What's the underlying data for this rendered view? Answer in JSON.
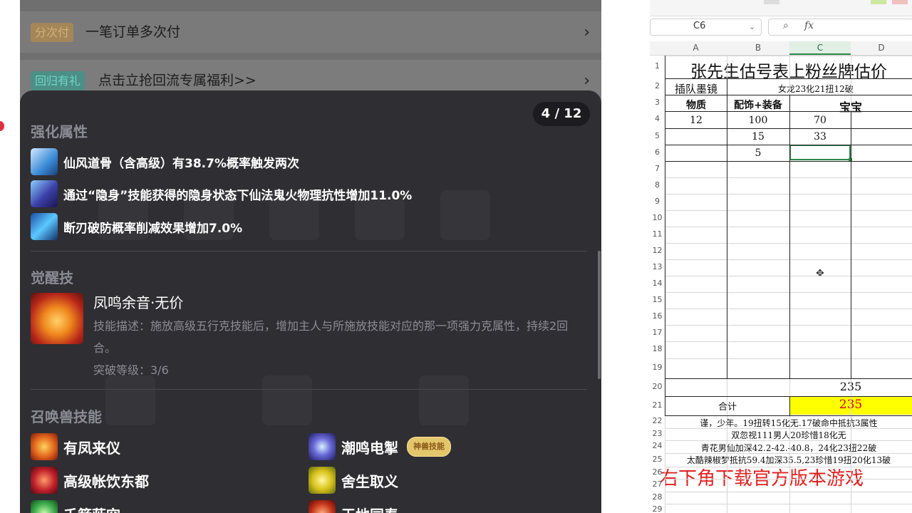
{
  "app": {
    "row1": {
      "tag": "分次付",
      "text": "一笔订单多次付"
    },
    "row2": {
      "tag": "回归有礼",
      "text": "点击立抢回流专属福利>>"
    },
    "chevron": "›"
  },
  "popup": {
    "counter": "4 / 12",
    "enhance": {
      "title": "强化属性",
      "items": [
        {
          "text": "仙风道骨（含高级）有38.7%概率触发两次",
          "icon": "immortal-icon"
        },
        {
          "text": "通过“隐身”技能获得的隐身状态下仙法鬼火物理抗性增加11.0%",
          "icon": "stealth-icon"
        },
        {
          "text": "断刃破防概率削减效果增加7.0%",
          "icon": "blade-icon"
        }
      ]
    },
    "awaken": {
      "title": "觉醒技",
      "name": "凤鸣余音·无价",
      "desc": "技能描述：施放高级五行克技能后，增加主人与所施放技能对应的那一项强力克属性，持续2回合。",
      "level": "突破等级：3/6"
    },
    "skills": {
      "title": "召唤兽技能",
      "items": [
        {
          "text": "有凤来仪",
          "icon": "phoenix-icon"
        },
        {
          "text": "潮鸣电掣",
          "icon": "thunder-icon",
          "badge": "神兽技能"
        },
        {
          "text": "高级帐饮东都",
          "icon": "feast-icon"
        },
        {
          "text": "舍生取义",
          "icon": "sacrifice-icon"
        },
        {
          "text": "千箭蔽空",
          "icon": "arrows-icon"
        },
        {
          "text": "天地同寿",
          "icon": "longevity-icon"
        }
      ]
    }
  },
  "excel": {
    "namebox": "C6",
    "fx": "fx",
    "columns": [
      "A",
      "B",
      "C",
      "D"
    ],
    "rows": [
      "1",
      "2",
      "3",
      "4",
      "5",
      "6",
      "7",
      "8",
      "9",
      "10",
      "11",
      "12",
      "13",
      "14",
      "15",
      "16",
      "17",
      "18",
      "19",
      "20",
      "21",
      "22",
      "23",
      "24",
      "25",
      "26",
      "27",
      "28",
      "29"
    ],
    "title": "张先生估号表上粉丝牌估价",
    "r2a": "插队墨镜",
    "r2b": "女龙23化21扭12破",
    "headers": {
      "a": "物质",
      "b": "配饰+装备",
      "c": "宝宝"
    },
    "r4": {
      "a": "12",
      "b": "100",
      "c": "70"
    },
    "r5": {
      "b": "15",
      "c": "33"
    },
    "r6": {
      "b": "5"
    },
    "r20c": "235",
    "total_label": "合计",
    "total_value": "235",
    "notes": [
      "谨，少年。19扭转15化无.17破命中抵抗3属性",
      "双忽视111男人20珍惜18化无",
      "青花男仙加深42.2-42.-40.8，24化23扭22破",
      "太酷辣椒梦抵抗59.4加深35.5,23珍惜19扭20化13破"
    ],
    "promo": "右下角下载官方版本游戏"
  },
  "colors": {
    "highlight": "#ffff00",
    "total_text": "#d00000",
    "promo": "#e02020",
    "selection": "#2a8a4a"
  }
}
